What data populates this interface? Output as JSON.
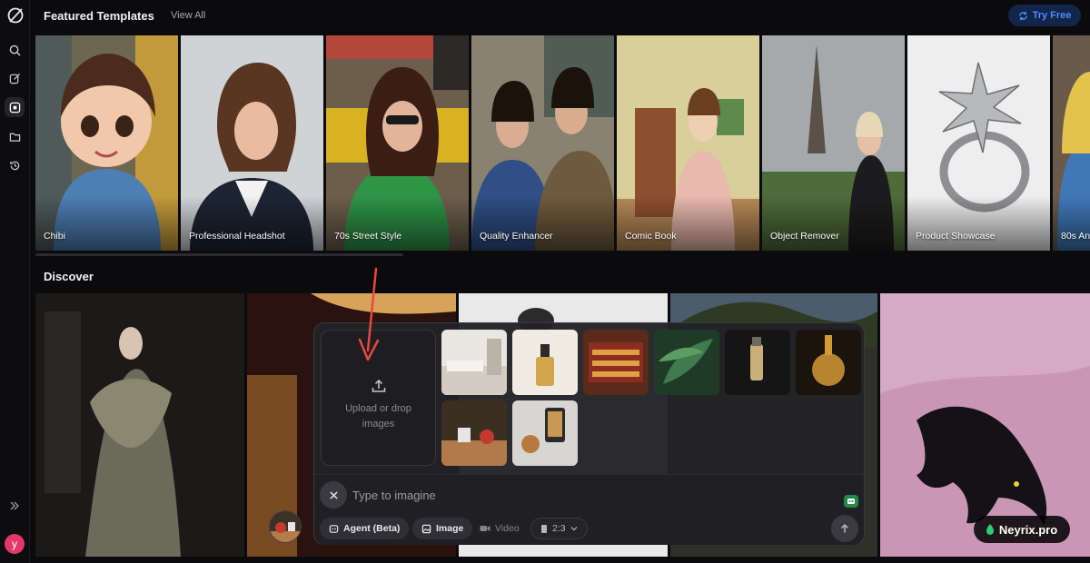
{
  "header": {
    "title": "Featured Templates",
    "view_all": "View All",
    "try_free": "Try Free",
    "accent": "#4e8cff"
  },
  "sidebar": {
    "items": [
      {
        "icon": "search-icon"
      },
      {
        "icon": "edit-icon"
      },
      {
        "icon": "templates-icon",
        "active": true
      },
      {
        "icon": "folder-icon"
      },
      {
        "icon": "history-icon"
      }
    ],
    "expand_icon": "double-chevron-right-icon",
    "avatar_letter": "y"
  },
  "templates": [
    {
      "label": "Chibi"
    },
    {
      "label": "Professional Headshot"
    },
    {
      "label": "70s Street Style"
    },
    {
      "label": "Quality Enhancer"
    },
    {
      "label": "Comic Book"
    },
    {
      "label": "Object Remover"
    },
    {
      "label": "Product Showcase"
    },
    {
      "label": "80s Ani"
    }
  ],
  "discover": {
    "title": "Discover"
  },
  "composer": {
    "upload_text": "Upload or drop images",
    "prompt_placeholder": "Type to imagine",
    "modes": {
      "agent": "Agent (Beta)",
      "image": "Image",
      "video": "Video",
      "ratio": "2:3"
    }
  },
  "watermark": "Neyrix.pro"
}
